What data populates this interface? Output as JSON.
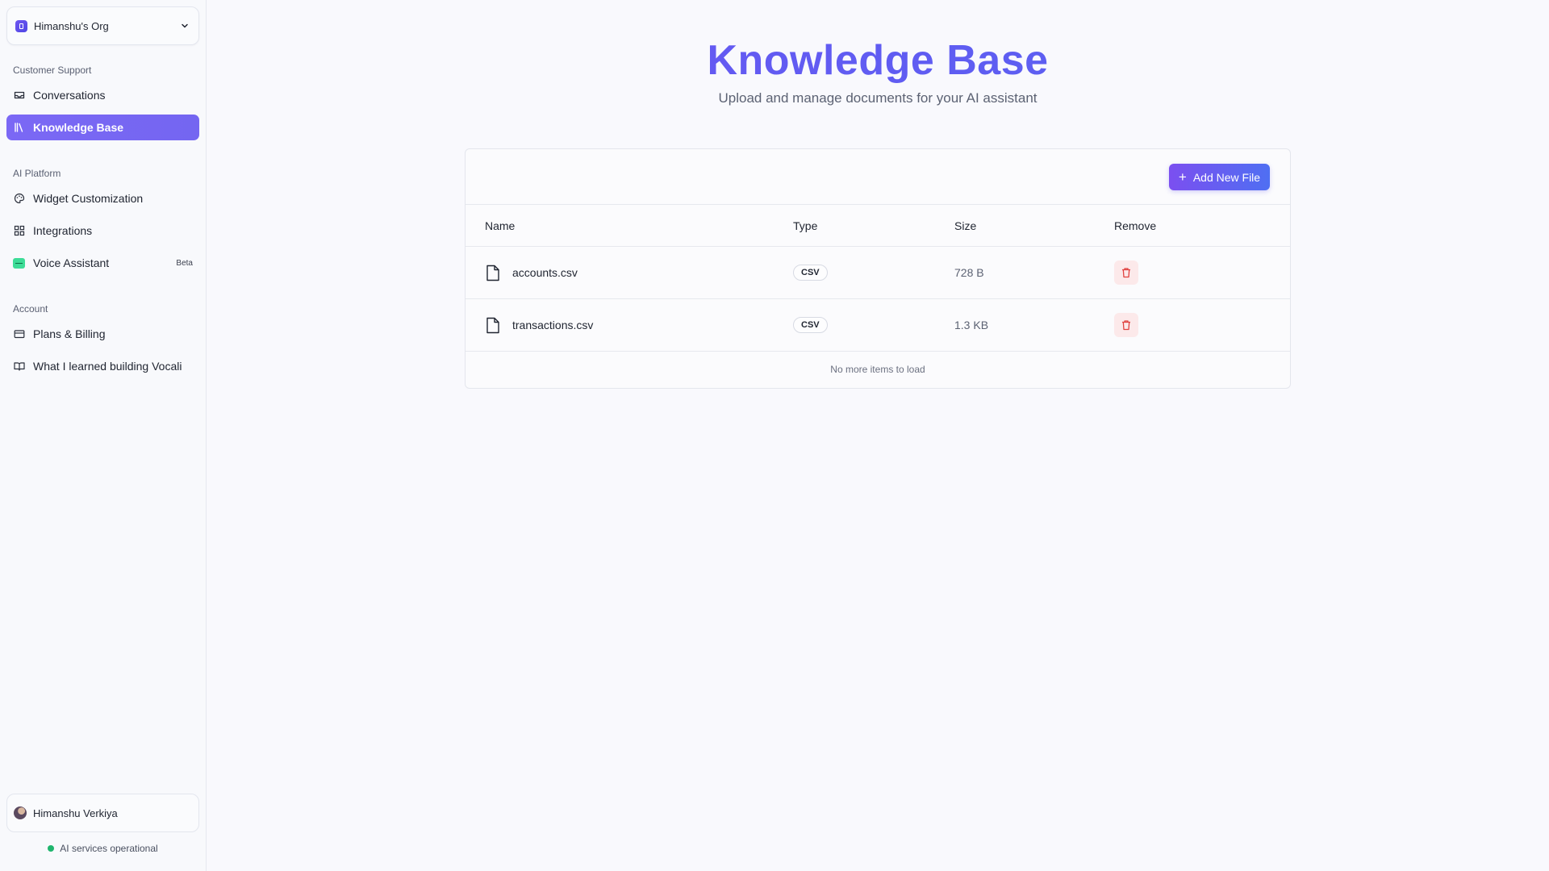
{
  "sidebar": {
    "org_name": "Himanshu's Org",
    "sections": {
      "customer_support": "Customer Support",
      "ai_platform": "AI Platform",
      "account": "Account"
    },
    "items": {
      "conversations": "Conversations",
      "knowledge_base": "Knowledge Base",
      "widget_customization": "Widget Customization",
      "integrations": "Integrations",
      "voice_assistant": "Voice Assistant",
      "voice_badge": "Beta",
      "plans_billing": "Plans & Billing",
      "learned": "What I learned building Vocali"
    },
    "active_item": "Knowledge Base",
    "user_name": "Himanshu Verkiya",
    "status_text": "AI services operational"
  },
  "main": {
    "title": "Knowledge Base",
    "subtitle": "Upload and manage documents for your AI assistant",
    "add_button": "Add New File",
    "columns": {
      "name": "Name",
      "type": "Type",
      "size": "Size",
      "remove": "Remove"
    },
    "files": [
      {
        "name": "accounts.csv",
        "type": "CSV",
        "size": "728 B"
      },
      {
        "name": "transactions.csv",
        "type": "CSV",
        "size": "1.3 KB"
      }
    ],
    "footer_text": "No more items to load"
  },
  "colors": {
    "accent": "#7466f1",
    "title_gradient_start": "#6d55f2",
    "delete_bg": "#fce9ea",
    "delete_icon": "#e0413f",
    "status_ok": "#1fb56d"
  }
}
